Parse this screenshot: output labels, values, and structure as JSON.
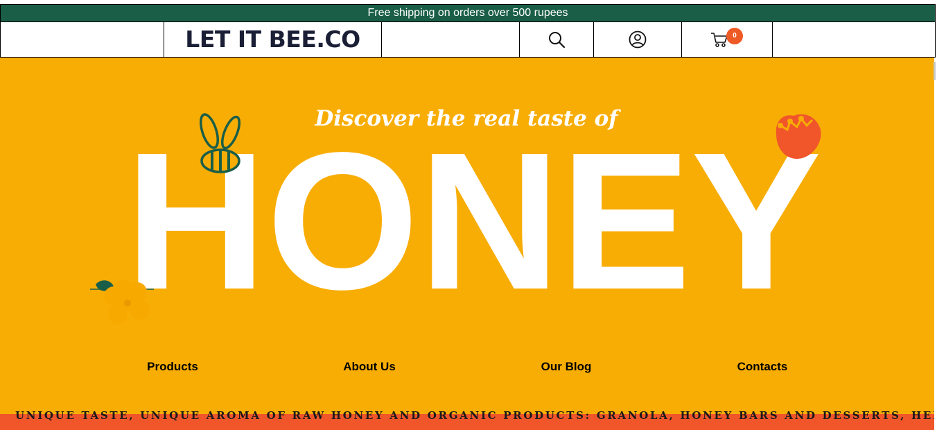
{
  "announcement": "Free shipping on orders over 500 rupees",
  "header": {
    "logo": "LET IT BEE.CO",
    "cart_count": "0",
    "icons": {
      "search": "search-icon",
      "account": "user-icon",
      "cart": "cart-icon"
    }
  },
  "hero": {
    "tagline": "Discover the real taste of",
    "headline": "HONEY",
    "decor": [
      "bee-icon",
      "flower-icon",
      "tulip-icon"
    ]
  },
  "nav": {
    "items": [
      {
        "label": "Products"
      },
      {
        "label": "About Us"
      },
      {
        "label": "Our Blog"
      },
      {
        "label": "Contacts"
      }
    ]
  },
  "marquee": "UNIQUE TASTE, UNIQUE AROMA OF RAW HONEY AND ORGANIC PRODUCTS: GRANOLA, HONEY BARS AND DESSERTS, HERBAL",
  "colors": {
    "brand_green": "#1a5e48",
    "hero_yellow": "#f8ad05",
    "accent_orange": "#f0562a",
    "logo_navy": "#1a1f36"
  }
}
